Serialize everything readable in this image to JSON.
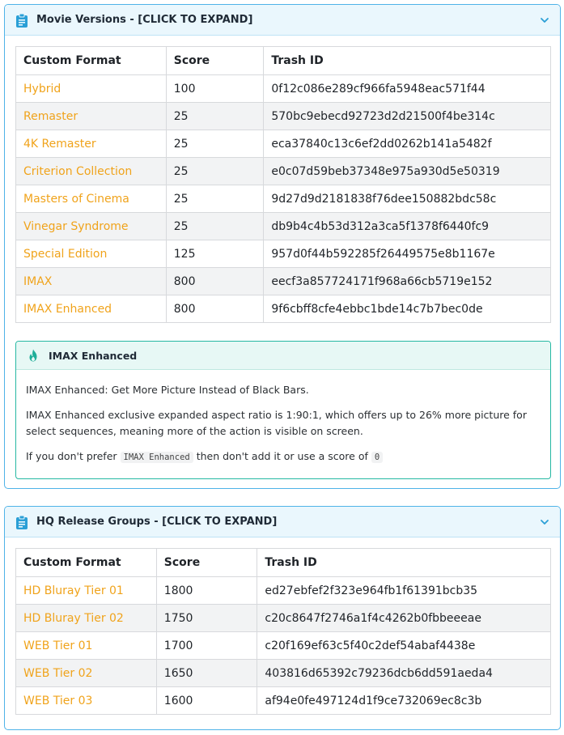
{
  "panels": {
    "movie_versions": {
      "title": "Movie Versions - [CLICK TO EXPAND]",
      "icon": "clipboard-icon",
      "toggle_icon": "chevron-down-icon",
      "table": {
        "headers": [
          "Custom Format",
          "Score",
          "Trash ID"
        ],
        "rows": [
          {
            "format": "Hybrid",
            "score": "100",
            "trash_id": "0f12c086e289cf966fa5948eac571f44"
          },
          {
            "format": "Remaster",
            "score": "25",
            "trash_id": "570bc9ebecd92723d2d21500f4be314c"
          },
          {
            "format": "4K Remaster",
            "score": "25",
            "trash_id": "eca37840c13c6ef2dd0262b141a5482f"
          },
          {
            "format": "Criterion Collection",
            "score": "25",
            "trash_id": "e0c07d59beb37348e975a930d5e50319"
          },
          {
            "format": "Masters of Cinema",
            "score": "25",
            "trash_id": "9d27d9d2181838f76dee150882bdc58c"
          },
          {
            "format": "Vinegar Syndrome",
            "score": "25",
            "trash_id": "db9b4c4b53d312a3ca5f1378f6440fc9"
          },
          {
            "format": "Special Edition",
            "score": "125",
            "trash_id": "957d0f44b592285f26449575e8b1167e"
          },
          {
            "format": "IMAX",
            "score": "800",
            "trash_id": "eecf3a857724171f968a66cb5719e152"
          },
          {
            "format": "IMAX Enhanced",
            "score": "800",
            "trash_id": "9f6cbff8cfe4ebbc1bde14c7b7bec0de"
          }
        ]
      },
      "note": {
        "icon": "flame-icon",
        "title": "IMAX Enhanced",
        "line1": "IMAX Enhanced: Get More Picture Instead of Black Bars.",
        "line2": "IMAX Enhanced exclusive expanded aspect ratio is 1:90:1, which offers up to 26% more picture for select sequences, meaning more of the action is visible on screen.",
        "line3_before": "If you don't prefer",
        "line3_code1": "IMAX Enhanced",
        "line3_middle": "then don't add it or use a score of",
        "line3_code2": "0"
      }
    },
    "hq_release_groups": {
      "title": "HQ Release Groups - [CLICK TO EXPAND]",
      "icon": "clipboard-icon",
      "toggle_icon": "chevron-down-icon",
      "table": {
        "headers": [
          "Custom Format",
          "Score",
          "Trash ID"
        ],
        "rows": [
          {
            "format": "HD Bluray Tier 01",
            "score": "1800",
            "trash_id": "ed27ebfef2f323e964fb1f61391bcb35"
          },
          {
            "format": "HD Bluray Tier 02",
            "score": "1750",
            "trash_id": "c20c8647f2746a1f4c4262b0fbbeeeae"
          },
          {
            "format": "WEB Tier 01",
            "score": "1700",
            "trash_id": "c20f169ef63c5f40c2def54abaf4438e"
          },
          {
            "format": "WEB Tier 02",
            "score": "1650",
            "trash_id": "403816d65392c79236dcb6dd591aeda4"
          },
          {
            "format": "WEB Tier 03",
            "score": "1600",
            "trash_id": "af94e0fe497124d1f9ce732069ec8c3b"
          }
        ]
      }
    }
  },
  "colors": {
    "panel_border": "#4fb3e8",
    "panel_header_bg": "#eaf7fd",
    "link": "#f0a31b",
    "note_border": "#26b8a3"
  }
}
